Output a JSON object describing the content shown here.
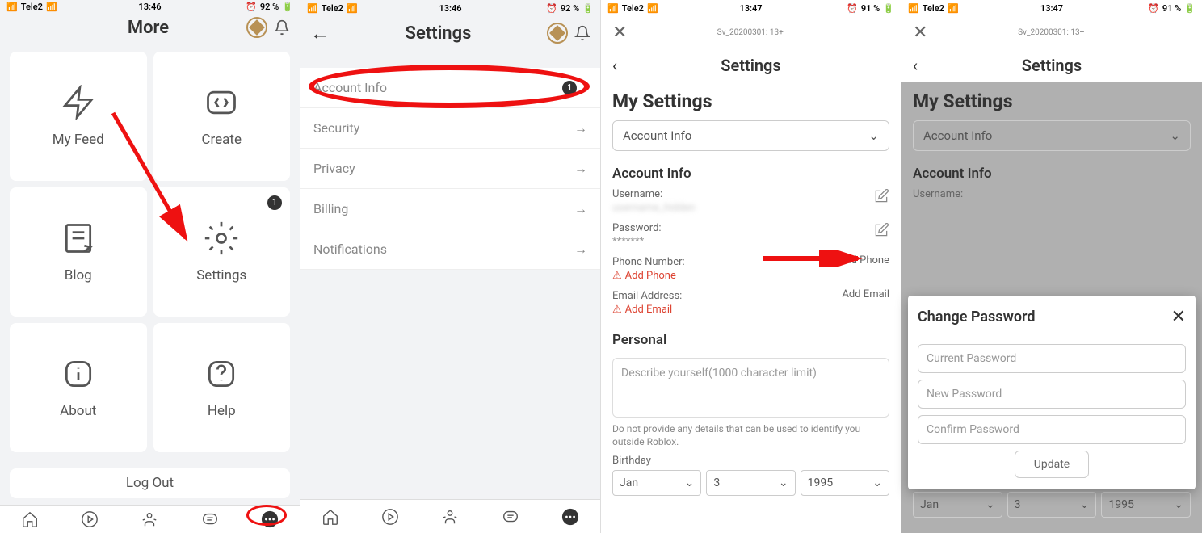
{
  "status": {
    "carrier": "Tele2",
    "time1": "13:46",
    "time2": "13:47",
    "battery1": "92 %",
    "battery2": "91 %"
  },
  "screen1": {
    "title": "More",
    "tiles": [
      {
        "label": "My Feed"
      },
      {
        "label": "Create"
      },
      {
        "label": "Blog"
      },
      {
        "label": "Settings",
        "badge": "1"
      },
      {
        "label": "About"
      },
      {
        "label": "Help"
      }
    ],
    "logout": "Log Out"
  },
  "screen2": {
    "title": "Settings",
    "rows": [
      {
        "label": "Account Info",
        "badge": "1"
      },
      {
        "label": "Security"
      },
      {
        "label": "Privacy"
      },
      {
        "label": "Billing"
      },
      {
        "label": "Notifications"
      }
    ]
  },
  "screen3": {
    "sv_label": "Sv_20200301: 13+",
    "title": "Settings",
    "heading": "My Settings",
    "dropdown": "Account Info",
    "section": "Account Info",
    "username_label": "Username:",
    "username_value": "",
    "password_label": "Password:",
    "password_value": "*******",
    "phone_label": "Phone Number:",
    "add_phone": "Add Phone",
    "add_phone_action": "Add Phone",
    "email_label": "Email Address:",
    "add_email": "Add Email",
    "add_email_action": "Add Email",
    "personal": "Personal",
    "describe_placeholder": "Describe yourself(1000 character limit)",
    "helper": "Do not provide any details that can be used to identify you outside Roblox.",
    "birthday": "Birthday",
    "bday_month": "Jan",
    "bday_day": "3",
    "bday_year": "1995"
  },
  "modal": {
    "title": "Change Password",
    "current": "Current Password",
    "new": "New Password",
    "confirm": "Confirm Password",
    "update": "Update"
  }
}
